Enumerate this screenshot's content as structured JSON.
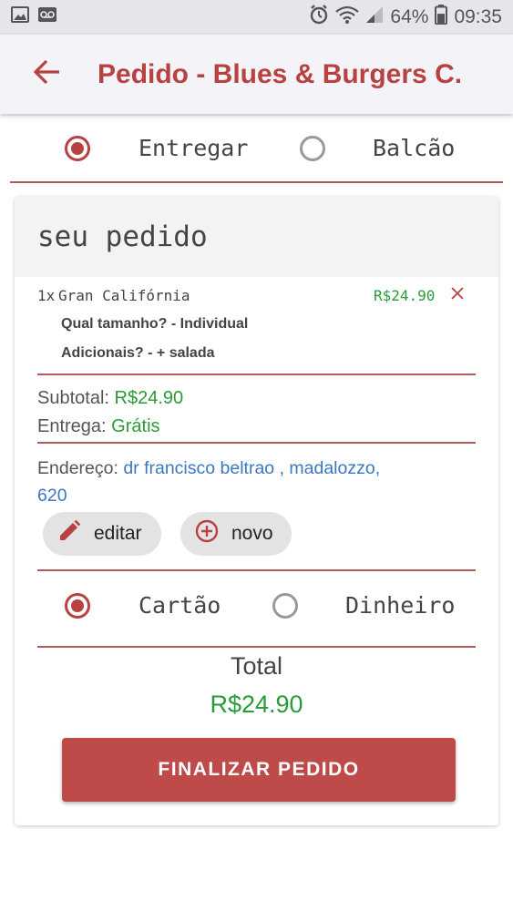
{
  "status_bar": {
    "icons_left": [
      "image-icon",
      "voicemail-icon"
    ],
    "icons_right": [
      "alarm-icon",
      "wifi-icon",
      "signal-icon"
    ],
    "battery": "64%",
    "time": "09:35",
    "battery_level": 0.64
  },
  "appbar": {
    "title": "Pedido - Blues & Burgers C..."
  },
  "delivery": {
    "selected": "Entregar",
    "options": [
      "Entregar",
      "Balcão"
    ]
  },
  "order": {
    "title": "seu pedido",
    "item": {
      "qty": "1x",
      "name": "Gran Califórnia",
      "price": "R$24.90",
      "remove_icon": "close-icon",
      "options": [
        "Qual tamanho? - Individual",
        "Adicionais? - + salada"
      ]
    },
    "subtotal_label": "Subtotal:",
    "subtotal_value": "R$24.90",
    "delivery_label": "Entrega:",
    "delivery_value": "Grátis",
    "address_label": "Endereço:",
    "address_line1": "dr francisco beltrao , madalozzo,",
    "address_line2": "620",
    "edit_label": "editar",
    "new_label": "novo"
  },
  "payment": {
    "selected": "Cartão",
    "options": [
      "Cartão",
      "Dinheiro"
    ]
  },
  "total": {
    "label": "Total",
    "value": "R$24.90"
  },
  "finalize_label": "FINALIZAR PEDIDO",
  "colors": {
    "accent": "#b84141",
    "price": "#2a9b3a",
    "link": "#3a78c0"
  }
}
